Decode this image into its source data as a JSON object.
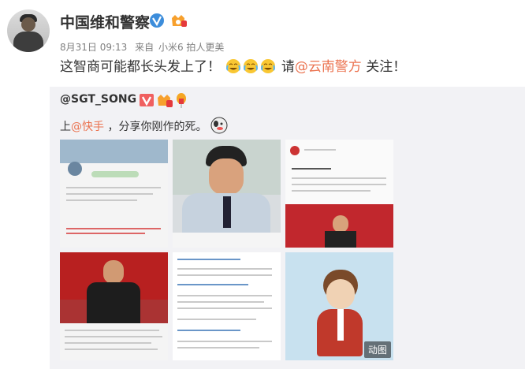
{
  "post": {
    "author": "中国维和警察",
    "time": "8月31日 09:13",
    "source_prefix": "来自",
    "source": "小米6 拍人更美",
    "text_before": "这智商可能都长头发上了！",
    "text_mid": "请",
    "mention": "@云南警方",
    "text_after": " 关注！"
  },
  "repost": {
    "author": "@SGT_SONG",
    "text_prefix": "上",
    "mention": "@快手",
    "text_after": " ，分享你刚作的死。",
    "gif_label": "动图"
  },
  "colors": {
    "mention": "#eb7350",
    "verify": "#3c8ddb",
    "repost_bg": "#f2f2f5"
  }
}
